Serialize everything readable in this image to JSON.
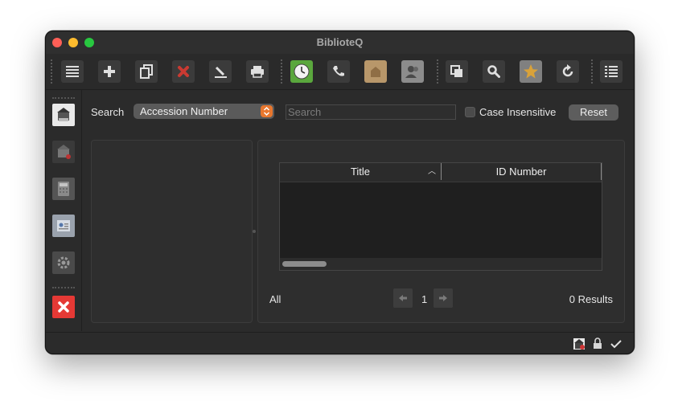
{
  "window": {
    "title": "BiblioteQ"
  },
  "toolbar": {
    "items": [
      {
        "icon": "list-icon"
      },
      {
        "icon": "add-icon"
      },
      {
        "icon": "copy-icon"
      },
      {
        "icon": "delete-icon"
      },
      {
        "icon": "edit-icon"
      },
      {
        "icon": "print-icon"
      },
      {
        "icon": "clock-icon"
      },
      {
        "icon": "phone-icon"
      },
      {
        "icon": "folder-icon"
      },
      {
        "icon": "members-icon"
      },
      {
        "icon": "duplicate-icon"
      },
      {
        "icon": "search-icon"
      },
      {
        "icon": "star-icon"
      },
      {
        "icon": "refresh-icon"
      },
      {
        "icon": "details-list-icon"
      }
    ]
  },
  "sidebar": {
    "items": [
      {
        "icon": "connect-icon"
      },
      {
        "icon": "disconnect-icon"
      },
      {
        "icon": "calculator-icon"
      },
      {
        "icon": "contact-card-icon"
      },
      {
        "icon": "settings-gear-icon"
      },
      {
        "icon": "exit-icon"
      }
    ]
  },
  "search_bar": {
    "label": "Search",
    "field_select": "Accession Number",
    "placeholder": "Search",
    "case_insensitive_label": "Case Insensitive",
    "case_insensitive_checked": false,
    "reset_label": "Reset"
  },
  "table": {
    "columns": [
      "Title",
      "ID Number"
    ],
    "sort_column": "Title",
    "rows": []
  },
  "pagination": {
    "filter_label": "All",
    "page": "1",
    "results": "0 Results"
  },
  "colors": {
    "window_bg": "#2b2b2b",
    "combo_accent": "#e8772e",
    "close_red": "#e53935",
    "clock_green": "#5aa73d",
    "folder_tan": "#b8976a",
    "star_gold": "#d9a23a"
  }
}
